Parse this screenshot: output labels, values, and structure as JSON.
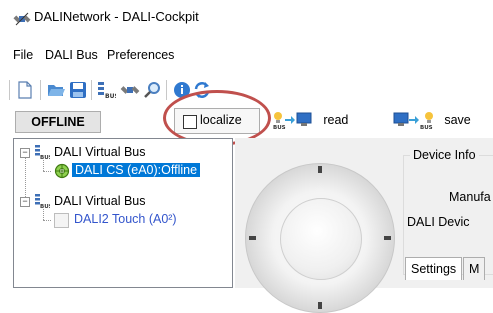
{
  "window": {
    "title": "DALINetwork - DALI-Cockpit"
  },
  "menu": {
    "items": [
      "File",
      "DALI Bus",
      "Preferences"
    ]
  },
  "toolbar": {
    "icons": [
      "new-file-icon",
      "open-folder-icon",
      "save-disk-icon",
      "bus-icon",
      "satellite-icon",
      "search-icon",
      "info-icon",
      "refresh-icon"
    ]
  },
  "row2": {
    "status": "OFFLINE",
    "localize_label": "localize",
    "localize_checked": false,
    "read_label": "read",
    "save_label": "save"
  },
  "tree": {
    "nodes": [
      {
        "label": "DALI Virtual Bus",
        "level": 0,
        "expanded": true
      },
      {
        "label": "DALI CS (eA0):Offline",
        "level": 1,
        "selected": true
      },
      {
        "label": "DALI Virtual Bus",
        "level": 0,
        "expanded": true
      },
      {
        "label": "DALI2 Touch (A0²)",
        "level": 1,
        "selected": false
      }
    ]
  },
  "device_panel": {
    "group_title": "Device Info",
    "lines": [
      "Manufa",
      "DALI Devic"
    ],
    "tabs": [
      "Settings",
      "M"
    ]
  },
  "colors": {
    "selection": "#0078d7",
    "highlight_ring": "#c0504d",
    "device_link_text": "#3355cc"
  }
}
